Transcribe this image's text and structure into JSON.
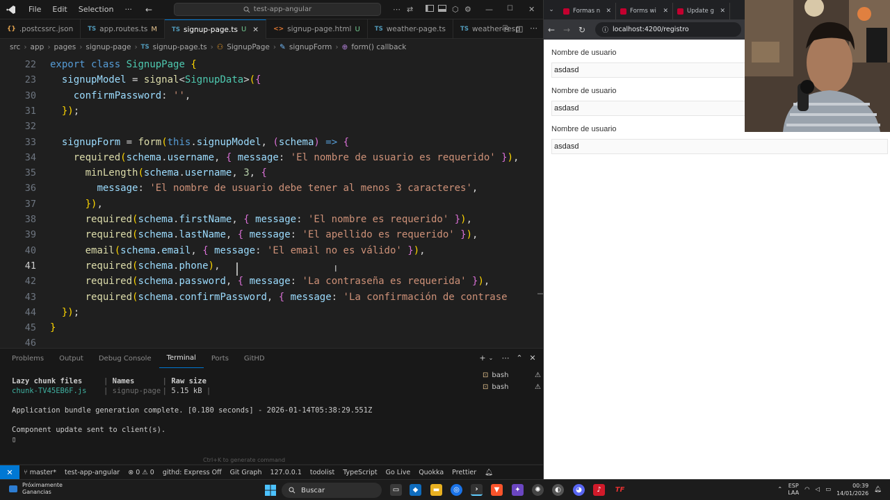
{
  "titlebar": {
    "menus": [
      "File",
      "Edit",
      "Selection",
      "···"
    ],
    "search": "test-app-angular"
  },
  "tabs": [
    {
      "icon": "css",
      "label": ".postcssrc.json",
      "mod": "",
      "active": false
    },
    {
      "icon": "TS",
      "label": "app.routes.ts",
      "mod": "M",
      "active": false
    },
    {
      "icon": "TS",
      "label": "signup-page.ts",
      "mod": "U",
      "active": true
    },
    {
      "icon": "html",
      "label": "signup-page.html",
      "mod": "U",
      "active": false
    },
    {
      "icon": "TS",
      "label": "weather-page.ts",
      "mod": "",
      "active": false
    },
    {
      "icon": "TS",
      "label": "weather-resp",
      "mod": "",
      "active": false
    }
  ],
  "breadcrumb": [
    "src",
    "app",
    "pages",
    "signup-page",
    "signup-page.ts",
    "SignupPage",
    "signupForm",
    "form() callback"
  ],
  "editor": {
    "current_line": "41",
    "lines": [
      {
        "n": "22",
        "t": "export class SignupPage {"
      },
      {
        "n": "23",
        "t": "  signupModel = signal<SignupData>({"
      },
      {
        "n": "30",
        "t": "    confirmPassword: '',"
      },
      {
        "n": "31",
        "t": "  });"
      },
      {
        "n": "32",
        "t": ""
      },
      {
        "n": "33",
        "t": "  signupForm = form(this.signupModel, (schema) => {"
      },
      {
        "n": "34",
        "t": "    required(schema.username, { message: 'El nombre de usuario es requerido' }),"
      },
      {
        "n": "35",
        "t": "      minLength(schema.username, 3, {"
      },
      {
        "n": "36",
        "t": "        message: 'El nombre de usuario debe tener al menos 3 caracteres',"
      },
      {
        "n": "37",
        "t": "      }),"
      },
      {
        "n": "38",
        "t": "      required(schema.firstName, { message: 'El nombre es requerido' }),"
      },
      {
        "n": "39",
        "t": "      required(schema.lastName, { message: 'El apellido es requerido' }),"
      },
      {
        "n": "40",
        "t": "      email(schema.email, { message: 'El email no es válido' }),"
      },
      {
        "n": "41",
        "t": "      required(schema.phone),"
      },
      {
        "n": "42",
        "t": "      required(schema.password, { message: 'La contraseña es requerida' }),"
      },
      {
        "n": "43",
        "t": "      required(schema.confirmPassword, { message: 'La confirmación de contrase"
      },
      {
        "n": "44",
        "t": "  });"
      },
      {
        "n": "45",
        "t": "}"
      },
      {
        "n": "46",
        "t": ""
      }
    ]
  },
  "panel": {
    "tabs": [
      "Problems",
      "Output",
      "Debug Console",
      "Terminal",
      "Ports",
      "GitHD"
    ],
    "active_tab": "Terminal",
    "terminal": {
      "header": {
        "c1": "Lazy chunk files",
        "c2": "Names",
        "c3": "Raw size"
      },
      "row": {
        "c1": "chunk-TV45EB6F.js",
        "c2": "signup-page",
        "c3": "5.15 kB"
      },
      "line1": "Application bundle generation complete. [0.180 seconds] - 2026-01-14T05:38:29.551Z",
      "line2": "Component update sent to client(s).",
      "prompt": "▯"
    },
    "terminals": [
      "bash",
      "bash"
    ],
    "hint": "Ctrl+K to generate command"
  },
  "statusbar": {
    "items": [
      "master*",
      "test-app-angular",
      "⊗ 0 ⚠ 0",
      "githd: Express Off",
      "Git Graph",
      "127.0.0.1",
      "todolist",
      "TypeScript",
      "Go Live",
      "Quokka",
      "Prettier"
    ]
  },
  "browser": {
    "tabs": [
      "Formas n",
      "Forms wi",
      "Update g"
    ],
    "url": "localhost:4200/registro",
    "fields": [
      {
        "label": "Nombre de usuario",
        "value": "asdasd"
      },
      {
        "label": "Nombre de usuario",
        "value": "asdasd"
      },
      {
        "label": "Nombre de usuario",
        "value": "asdasd"
      }
    ]
  },
  "taskbar": {
    "weather_title": "Próximamente",
    "weather_sub": "Ganancias",
    "search": "Buscar",
    "lang1": "ESP",
    "lang2": "LAA",
    "time": "00:39",
    "date": "14/01/2026"
  },
  "colors": {
    "accent": "#0078d4",
    "editor_bg": "#1f1f1f",
    "ts_icon": "#519aba",
    "modified": "#e2c08d",
    "untracked": "#73c991"
  }
}
